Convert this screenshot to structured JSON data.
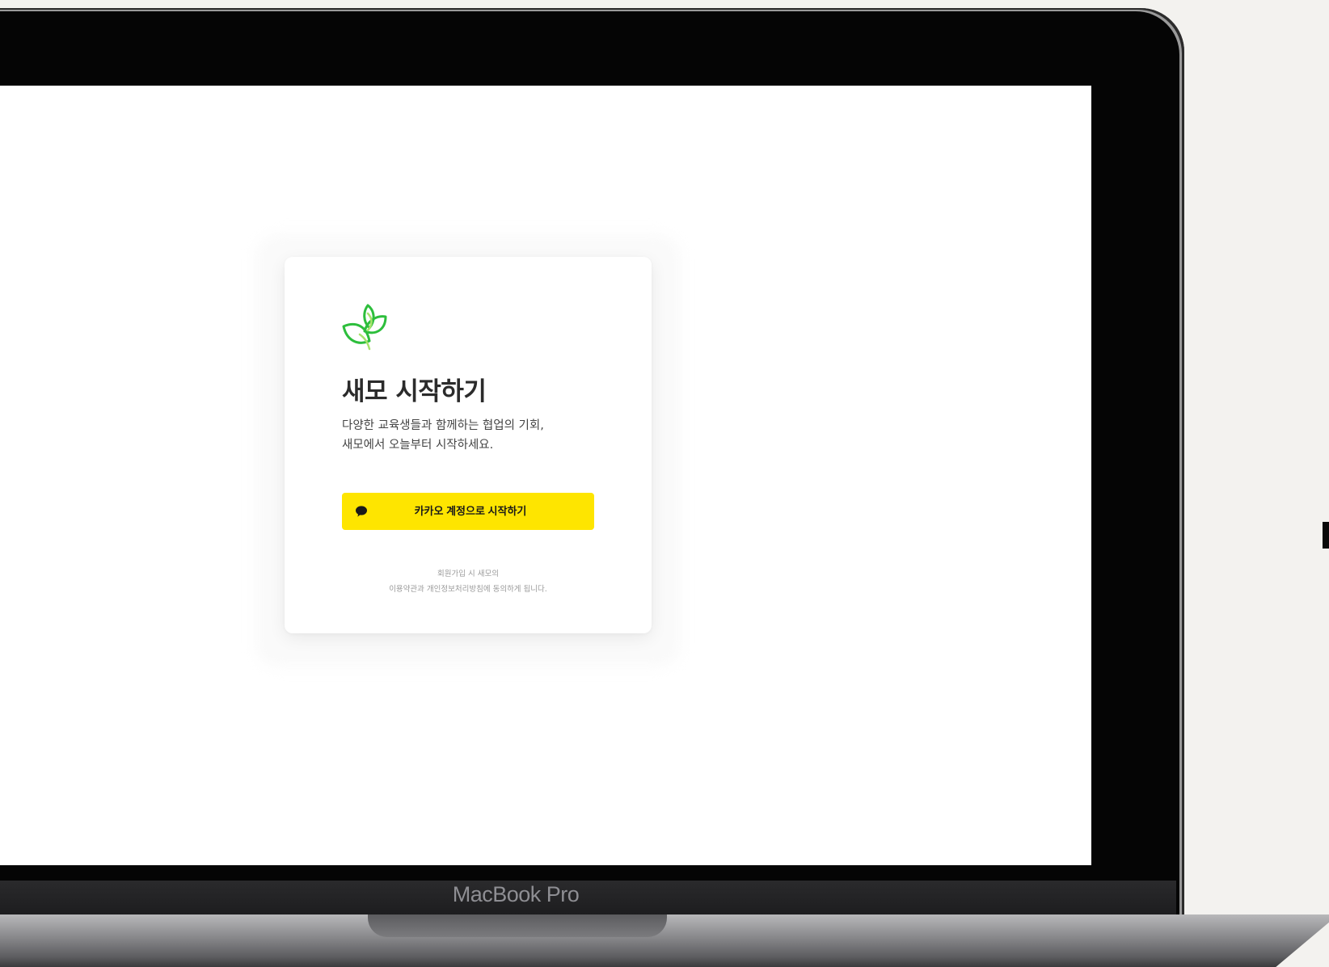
{
  "device": {
    "label": "MacBook Pro"
  },
  "login_card": {
    "title": "새모 시작하기",
    "description_line1": "다양한 교육생들과 함께하는 협업의 기회,",
    "description_line2": "새모에서 오늘부터 시작하세요.",
    "kakao_button_label": "카카오 계정으로 시작하기",
    "terms_line1": "회원가입 시 새모의",
    "terms_line2": "이용약관과 개인정보처리방침에 동의하게 됩니다.",
    "icons": {
      "logo": "leaf-logo-icon",
      "kakao": "speech-bubble-icon"
    },
    "colors": {
      "kakao_yellow": "#FEE500",
      "logo_green": "#2DBE3C",
      "logo_light_green": "#A6E36B"
    }
  }
}
